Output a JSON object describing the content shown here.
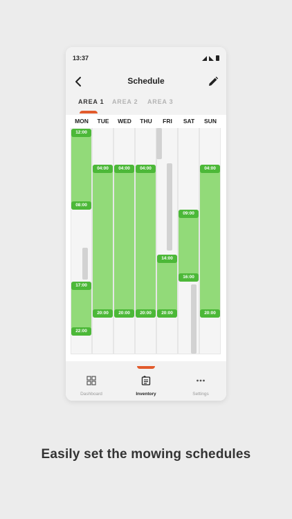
{
  "status_bar": {
    "time": "13:37"
  },
  "app_bar": {
    "title": "Schedule",
    "back_icon": "back-arrow-icon",
    "edit_icon": "pencil-icon"
  },
  "tabs": [
    {
      "label": "AREA 1",
      "active": true
    },
    {
      "label": "AREA 2",
      "active": false
    },
    {
      "label": "AREA 3",
      "active": false
    }
  ],
  "days": [
    "MON",
    "TUE",
    "WED",
    "THU",
    "FRI",
    "SAT",
    "SUN"
  ],
  "schedule": {
    "mon": [
      {
        "start": "12:00",
        "end": "08:00"
      },
      {
        "start": "17:00",
        "end": "22:00"
      }
    ],
    "tue": [
      {
        "start": "04:00",
        "end": "20:00"
      }
    ],
    "wed": [
      {
        "start": "04:00",
        "end": "20:00"
      }
    ],
    "thu": [
      {
        "start": "04:00",
        "end": "20:00"
      }
    ],
    "fri": [
      {
        "start": "14:00",
        "end": "20:00"
      }
    ],
    "sat": [
      {
        "start": "09:00",
        "end": "16:00"
      }
    ],
    "sun": [
      {
        "start": "04:00",
        "end": "20:00"
      }
    ]
  },
  "colors": {
    "accent": "#e25b2c",
    "mow_fill": "#92da79",
    "mow_tag": "#4cb838",
    "blocked": "#d2d2d2"
  },
  "bottom_nav": [
    {
      "label": "Dashboard",
      "icon": "grid-icon",
      "active": false
    },
    {
      "label": "Inventory",
      "icon": "inventory-icon",
      "active": true
    },
    {
      "label": "Settings",
      "icon": "more-dots-icon",
      "active": false
    }
  ],
  "caption": "Easily set the mowing schedules"
}
